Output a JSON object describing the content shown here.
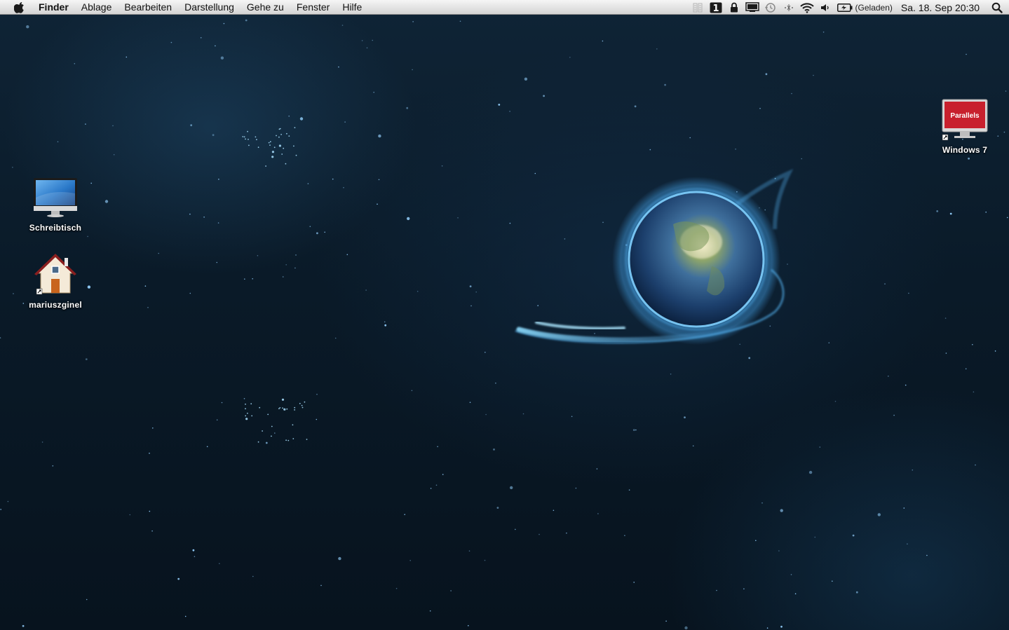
{
  "menubar": {
    "apple_icon": "apple-logo-icon",
    "app_name": "Finder",
    "menus": [
      "Ablage",
      "Bearbeiten",
      "Darstellung",
      "Gehe zu",
      "Fenster",
      "Hilfe"
    ],
    "status_icons": [
      "menu-extra-icon",
      "script-icon",
      "lock-icon",
      "display-mirror-icon",
      "time-machine-icon",
      "bluetooth-icon",
      "wifi-icon",
      "volume-icon"
    ],
    "battery_icon": "battery-charging-icon",
    "battery_status": "(Geladen)",
    "clock": "Sa. 18. Sep  20:30",
    "spotlight_icon": "spotlight-search-icon"
  },
  "desktop": {
    "icons": [
      {
        "label": "Schreibtisch",
        "icon": "imac-icon"
      },
      {
        "label": "mariuszginel",
        "icon": "home-folder-icon"
      },
      {
        "label": "Windows 7",
        "icon": "parallels-vm-icon",
        "badge": "Parallels"
      }
    ]
  },
  "colors": {
    "wallpaper": "#0a1a28",
    "glow": "#4fc3ff",
    "parallels_red": "#c8202d"
  }
}
